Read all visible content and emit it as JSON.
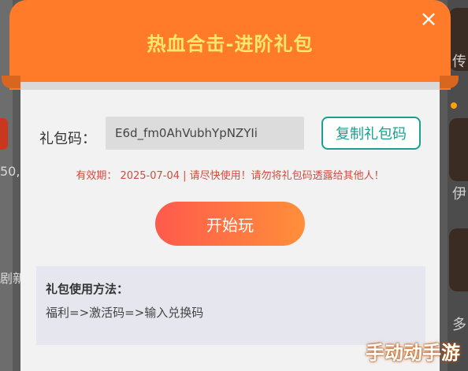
{
  "modal": {
    "title": "热血合击-进阶礼包",
    "close": "×",
    "code_label": "礼包码：",
    "gift_code": "E6d_fm0AhVubhYpNZYIi",
    "copy_button": "复制礼包码",
    "expiry_text": "有效期：  2025-07-04 | 请尽快使用！请勿将礼包码透露给其他人！",
    "play_button": "开始玩",
    "usage": {
      "title": "礼包使用方法：",
      "text": "福利=>激活码=>输入兑换码"
    }
  },
  "background": {
    "left_texts": [
      "50,",
      "剧新"
    ],
    "right_texts": [
      "传",
      "伊",
      "多"
    ]
  },
  "watermark": "手动动手游",
  "colors": {
    "header": "#ff7b2a",
    "title": "#ffe76b",
    "copy_border": "#1aa08f",
    "expiry": "#d14b3d",
    "play_start": "#ff5a4c",
    "play_end": "#ff8f3a"
  }
}
